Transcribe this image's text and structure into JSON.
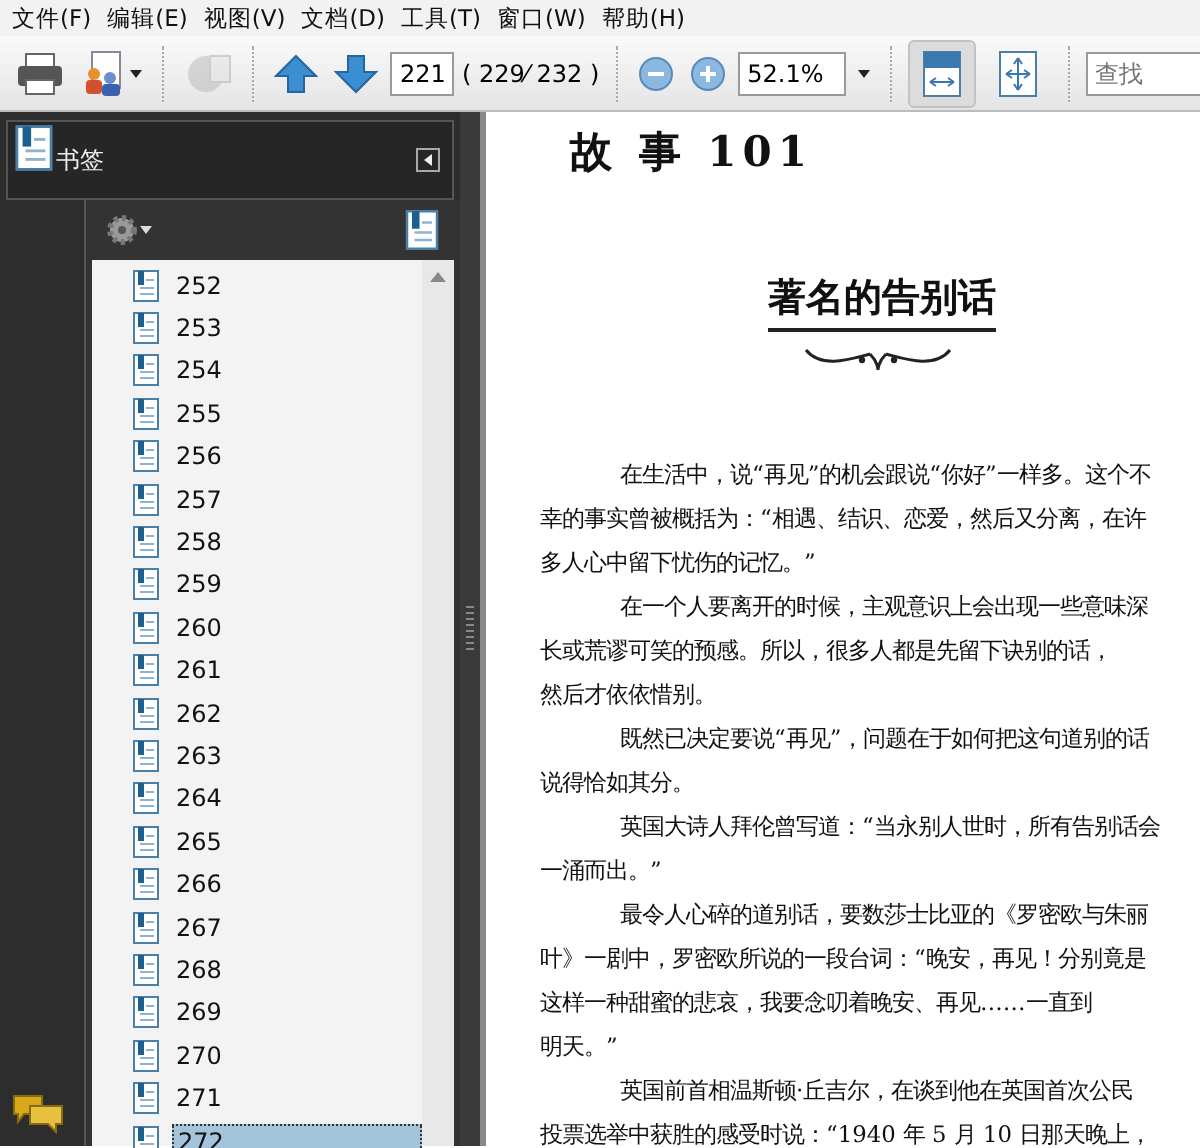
{
  "menu": [
    "文件(F)",
    "编辑(E)",
    "视图(V)",
    "文档(D)",
    "工具(T)",
    "窗口(W)",
    "帮助(H)"
  ],
  "toolbar": {
    "file_buttons": [
      {
        "kind": "print",
        "disabled": false
      },
      {
        "kind": "create",
        "disabled": false
      },
      {
        "kind": "share",
        "disabled": true
      }
    ],
    "page_field": "221",
    "page_count": "( 229⁄ 232 )",
    "zoom_field": "52.1%",
    "view_buttons": [
      {
        "kind": "fit-width",
        "selected": true
      },
      {
        "kind": "fit-page",
        "selected": false
      }
    ],
    "search": {
      "placeholder": "查找"
    }
  },
  "bookmarks_panel": {
    "title": "书签",
    "items": [
      {
        "label": "252",
        "selected": false
      },
      {
        "label": "253",
        "selected": false
      },
      {
        "label": "254",
        "selected": false
      },
      {
        "label": "255",
        "selected": false
      },
      {
        "label": "256",
        "selected": false
      },
      {
        "label": "257",
        "selected": false
      },
      {
        "label": "258",
        "selected": false
      },
      {
        "label": "259",
        "selected": false
      },
      {
        "label": "260",
        "selected": false
      },
      {
        "label": "261",
        "selected": false
      },
      {
        "label": "262",
        "selected": false
      },
      {
        "label": "263",
        "selected": false
      },
      {
        "label": "264",
        "selected": false
      },
      {
        "label": "265",
        "selected": false
      },
      {
        "label": "266",
        "selected": false
      },
      {
        "label": "267",
        "selected": false
      },
      {
        "label": "268",
        "selected": false
      },
      {
        "label": "269",
        "selected": false
      },
      {
        "label": "270",
        "selected": false
      },
      {
        "label": "271",
        "selected": false
      },
      {
        "label": "272",
        "selected": true
      }
    ]
  },
  "document": {
    "running_head": "故 事 101",
    "title": "著名的告别话",
    "paragraphs": [
      {
        "lines": [
          "在生活中，说“再见”的机会跟说“你好”一样多。这个不",
          "幸的事实曾被概括为：“相遇、结识、恋爱，然后又分离，在许",
          "多人心中留下忧伤的记忆。”"
        ]
      },
      {
        "lines": [
          "在一个人要离开的时候，主观意识上会出现一些意味深",
          "长或荒谬可笑的预感。所以，很多人都是先留下诀别的话，",
          "然后才依依惜别。"
        ]
      },
      {
        "lines": [
          "既然已决定要说“再见”，问题在于如何把这句道别的话",
          "说得恰如其分。"
        ]
      },
      {
        "lines": [
          "英国大诗人拜伦曾写道：“当永别人世时，所有告别话会",
          "一涌而出。”"
        ]
      },
      {
        "lines": [
          "最令人心碎的道别话，要数莎士比亚的《罗密欧与朱丽",
          "叶》一剧中，罗密欧所说的一段台词：“晚安，再见！分别竟是",
          "这样一种甜蜜的悲哀，我要念叨着晚安、再见……一直到",
          "明天。”"
        ]
      },
      {
        "lines": [
          "英国前首相温斯顿·丘吉尔，在谈到他在英国首次公民",
          "投票选举中获胜的感受时说：“1940 年 5 月 10 日那天晚上，"
        ]
      }
    ]
  }
}
